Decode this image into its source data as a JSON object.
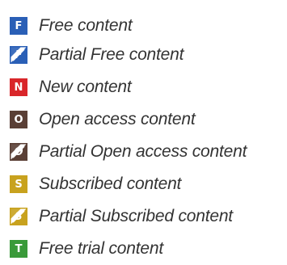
{
  "legend": {
    "items": [
      {
        "key": "free",
        "letter": "F",
        "label": "Free content",
        "color": "#2a5fb6",
        "icon": "free-content-icon",
        "partial": false
      },
      {
        "key": "partial-free",
        "letter": "F",
        "label": "Partial Free content",
        "color": "#2a5fb6",
        "icon": "partial-free-content-icon",
        "partial": true
      },
      {
        "key": "new",
        "letter": "N",
        "label": "New content",
        "color": "#d9262a",
        "icon": "new-content-icon",
        "partial": false
      },
      {
        "key": "open-access",
        "letter": "O",
        "label": "Open access content",
        "color": "#5a3f35",
        "icon": "open-access-content-icon",
        "partial": false
      },
      {
        "key": "partial-open-access",
        "letter": "O",
        "label": "Partial Open access content",
        "color": "#5a3f35",
        "icon": "partial-open-access-content-icon",
        "partial": true
      },
      {
        "key": "subscribed",
        "letter": "S",
        "label": "Subscribed content",
        "color": "#c8a21e",
        "icon": "subscribed-content-icon",
        "partial": false
      },
      {
        "key": "partial-subscribed",
        "letter": "S",
        "label": "Partial Subscribed content",
        "color": "#c8a21e",
        "icon": "partial-subscribed-content-icon",
        "partial": true
      },
      {
        "key": "free-trial",
        "letter": "T",
        "label": "Free trial content",
        "color": "#3a9a3a",
        "icon": "free-trial-content-icon",
        "partial": false
      }
    ]
  }
}
